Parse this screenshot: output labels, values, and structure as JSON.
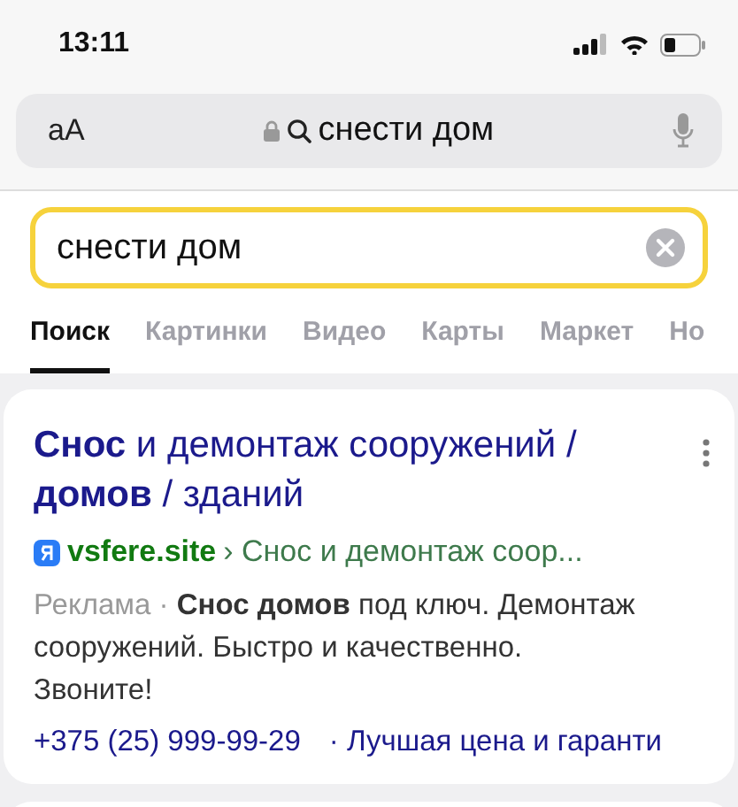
{
  "status_bar": {
    "time": "13:11"
  },
  "address_bar": {
    "text_size_label": "аА",
    "query": "снести дом"
  },
  "search": {
    "value": "снести дом"
  },
  "tabs": [
    {
      "label": "Поиск",
      "selected": true
    },
    {
      "label": "Картинки",
      "selected": false
    },
    {
      "label": "Видео",
      "selected": false
    },
    {
      "label": "Карты",
      "selected": false
    },
    {
      "label": "Маркет",
      "selected": false
    },
    {
      "label": "Но",
      "selected": false
    }
  ],
  "result": {
    "title": "**Снос** и демонтаж сооружений / **домов** / зданий",
    "site": "vsfere.site",
    "breadcrumb": "› Снос и демонтаж соор...",
    "ad_label": "Реклама ·",
    "description": "**Снос домов** под ключ. Демонтаж сооружений. Быстро и качественно. Звоните!",
    "phone": "+375 (25) 999-99-29",
    "sitelink": "· Лучшая цена и гаранти"
  }
}
